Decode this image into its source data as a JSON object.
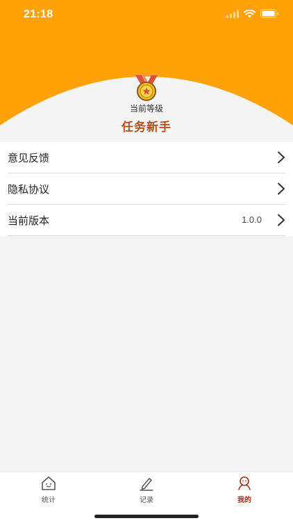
{
  "status_bar": {
    "time": "21:18"
  },
  "profile": {
    "level_caption": "当前等级",
    "level_name": "任务新手"
  },
  "menu": {
    "items": [
      {
        "label": "意见反馈"
      },
      {
        "label": "隐私协议"
      },
      {
        "label": "当前版本",
        "value": "1.0.0"
      }
    ]
  },
  "tabbar": {
    "tabs": [
      {
        "label": "统计",
        "icon": "house-face-icon",
        "active": false
      },
      {
        "label": "记录",
        "icon": "pencil-icon",
        "active": false
      },
      {
        "label": "我的",
        "icon": "person-face-icon",
        "active": true
      }
    ]
  },
  "colors": {
    "header_orange": "#ffa20a",
    "level_title": "#b3541e",
    "active_tab": "#a0301a"
  }
}
